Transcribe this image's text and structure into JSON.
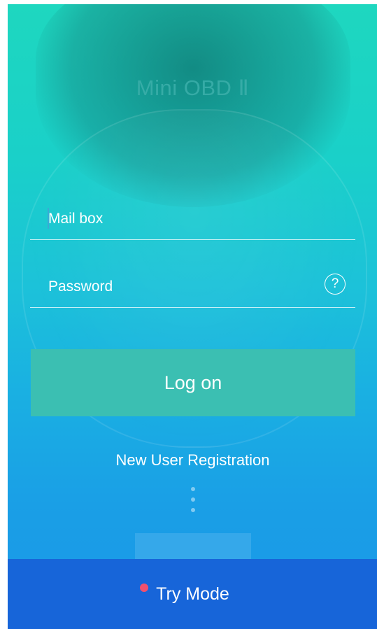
{
  "app": {
    "title": "Mini OBD Ⅱ"
  },
  "login_form": {
    "email_placeholder": "Mail box",
    "password_placeholder": "Password",
    "help_icon_glyph": "?",
    "login_label": "Log on"
  },
  "links": {
    "register_label": "New User Registration"
  },
  "footer": {
    "try_mode_label": "Try Mode"
  },
  "colors": {
    "button": "#3bbfb2",
    "footer_bar": "#1765d9",
    "notification_dot": "#f0506e"
  }
}
